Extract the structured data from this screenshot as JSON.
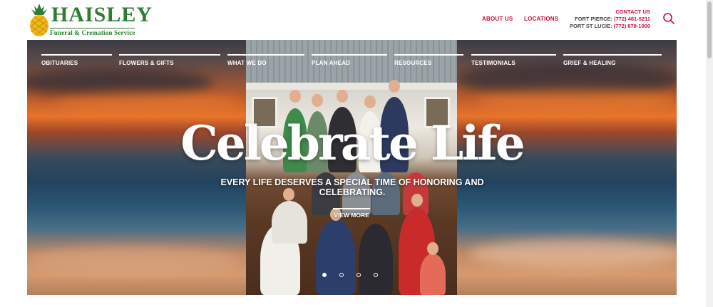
{
  "brand": {
    "name": "HAISLEY",
    "tagline": "Funeral & Cremation Service"
  },
  "header": {
    "about_us": "ABOUT US",
    "locations": "LOCATIONS",
    "contact_title": "CONTACT US",
    "contacts": [
      {
        "label": "FORT PIERCE:",
        "phone": "(772) 461-5211"
      },
      {
        "label": "PORT ST LUCIE:",
        "phone": "(772) 879-1000"
      }
    ],
    "search_icon": "search-icon"
  },
  "nav": [
    {
      "label": "OBITUARIES"
    },
    {
      "label": "FLOWERS & GIFTS"
    },
    {
      "label": "WHAT WE DO"
    },
    {
      "label": "PLAN AHEAD"
    },
    {
      "label": "RESOURCES"
    },
    {
      "label": "TESTIMONIALS"
    },
    {
      "label": "GRIEF & HEALING"
    }
  ],
  "hero": {
    "headline": "Celebrate Life",
    "subheadline": "EVERY LIFE DESERVES A SPECIAL TIME OF HONORING AND CELEBRATING.",
    "cta": "VIEW MORE",
    "slides": 4,
    "active_slide": 1
  },
  "colors": {
    "accent": "#c8103e",
    "brand_green": "#2e7d32"
  }
}
